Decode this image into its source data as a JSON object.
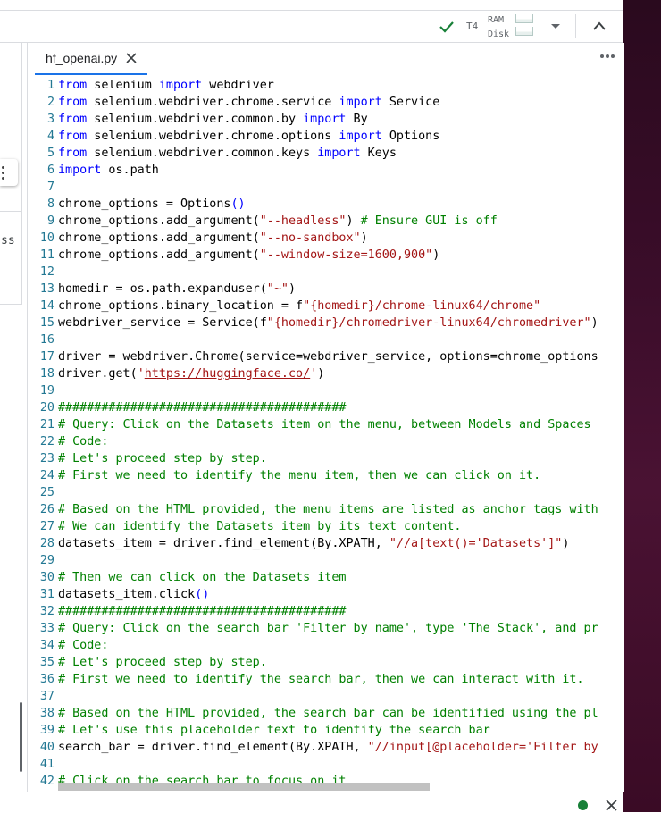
{
  "status": {
    "runtime": "T4",
    "ram_label": "RAM",
    "disk_label": "Disk"
  },
  "left_panel": {
    "partial_text": "ss"
  },
  "editor": {
    "tab_name": "hf_openai.py"
  },
  "code_lines": [
    "from selenium import webdriver",
    "from selenium.webdriver.chrome.service import Service",
    "from selenium.webdriver.common.by import By",
    "from selenium.webdriver.chrome.options import Options",
    "from selenium.webdriver.common.keys import Keys",
    "import os.path",
    "",
    "chrome_options = Options()",
    "chrome_options.add_argument(\"--headless\") # Ensure GUI is off",
    "chrome_options.add_argument(\"--no-sandbox\")",
    "chrome_options.add_argument(\"--window-size=1600,900\")",
    "",
    "homedir = os.path.expanduser(\"~\")",
    "chrome_options.binary_location = f\"{homedir}/chrome-linux64/chrome\"",
    "webdriver_service = Service(f\"{homedir}/chromedriver-linux64/chromedriver\")",
    "",
    "driver = webdriver.Chrome(service=webdriver_service, options=chrome_options",
    "driver.get('https://huggingface.co/')",
    "",
    "########################################",
    "# Query: Click on the Datasets item on the menu, between Models and Spaces",
    "# Code:",
    "# Let's proceed step by step.",
    "# First we need to identify the menu item, then we can click on it.",
    "",
    "# Based on the HTML provided, the menu items are listed as anchor tags with",
    "# We can identify the Datasets item by its text content.",
    "datasets_item = driver.find_element(By.XPATH, \"//a[text()='Datasets']\")",
    "",
    "# Then we can click on the Datasets item",
    "datasets_item.click()",
    "########################################",
    "# Query: Click on the search bar 'Filter by name', type 'The Stack', and pr",
    "# Code:",
    "# Let's proceed step by step.",
    "# First we need to identify the search bar, then we can interact with it.",
    "",
    "# Based on the HTML provided, the search bar can be identified using the pl",
    "# Let's use this placeholder text to identify the search bar",
    "search_bar = driver.find_element(By.XPATH, \"//input[@placeholder='Filter by",
    "",
    "# Click on the search bar to focus on it"
  ]
}
